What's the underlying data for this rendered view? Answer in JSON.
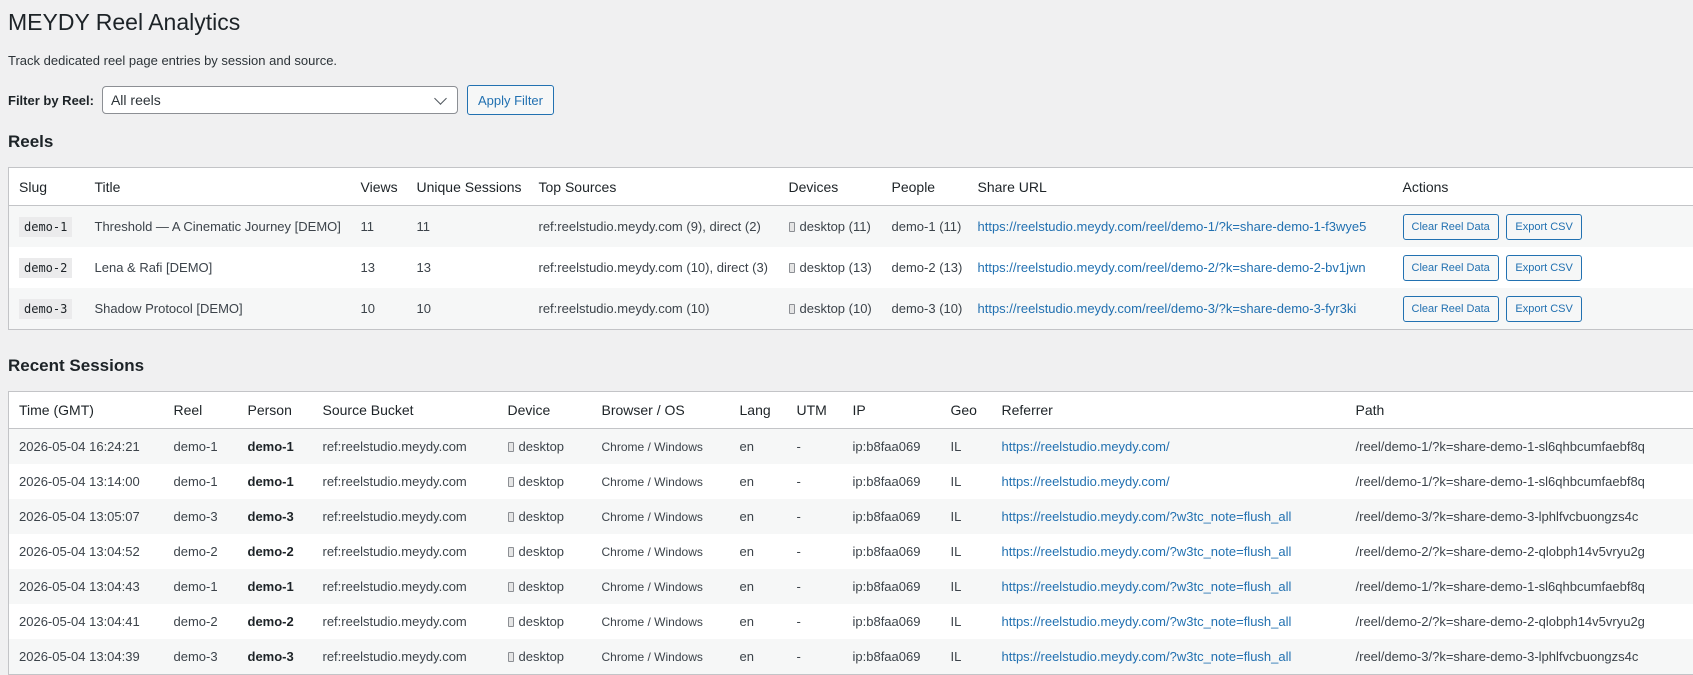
{
  "page": {
    "title": "MEYDY Reel Analytics",
    "description": "Track dedicated reel page entries by session and source."
  },
  "filter": {
    "label": "Filter by Reel:",
    "selected": "All reels",
    "apply_label": "Apply Filter"
  },
  "reels": {
    "heading": "Reels",
    "columns": [
      "Slug",
      "Title",
      "Views",
      "Unique Sessions",
      "Top Sources",
      "Devices",
      "People",
      "Share URL",
      "Actions"
    ],
    "rows": [
      {
        "slug": "demo-1",
        "title": "Threshold — A Cinematic Journey [DEMO]",
        "views": "11",
        "unique": "11",
        "sources": "ref:reelstudio.meydy.com (9), direct (2)",
        "devices": "desktop (11)",
        "people": "demo-1 (11)",
        "url": "https://reelstudio.meydy.com/reel/demo-1/?k=share-demo-1-f3wye5"
      },
      {
        "slug": "demo-2",
        "title": "Lena & Rafi [DEMO]",
        "views": "13",
        "unique": "13",
        "sources": "ref:reelstudio.meydy.com (10), direct (3)",
        "devices": "desktop (13)",
        "people": "demo-2 (13)",
        "url": "https://reelstudio.meydy.com/reel/demo-2/?k=share-demo-2-bv1jwn"
      },
      {
        "slug": "demo-3",
        "title": "Shadow Protocol [DEMO]",
        "views": "10",
        "unique": "10",
        "sources": "ref:reelstudio.meydy.com (10)",
        "devices": "desktop (10)",
        "people": "demo-3 (10)",
        "url": "https://reelstudio.meydy.com/reel/demo-3/?k=share-demo-3-fyr3ki"
      }
    ],
    "clear_label": "Clear Reel Data",
    "export_label": "Export CSV"
  },
  "sessions": {
    "heading": "Recent Sessions",
    "columns": [
      "Time (GMT)",
      "Reel",
      "Person",
      "Source Bucket",
      "Device",
      "Browser / OS",
      "Lang",
      "UTM",
      "IP",
      "Geo",
      "Referrer",
      "Path"
    ],
    "rows": [
      {
        "time": "2026-05-04 16:24:21",
        "reel": "demo-1",
        "person": "demo-1",
        "source": "ref:reelstudio.meydy.com",
        "device": "desktop",
        "browser": "Chrome / Windows",
        "lang": "en",
        "utm": "-",
        "ip": "ip:b8faa069",
        "geo": "IL",
        "referrer": "https://reelstudio.meydy.com/",
        "path": "/reel/demo-1/?k=share-demo-1-sl6qhbcumfaebf8q"
      },
      {
        "time": "2026-05-04 13:14:00",
        "reel": "demo-1",
        "person": "demo-1",
        "source": "ref:reelstudio.meydy.com",
        "device": "desktop",
        "browser": "Chrome / Windows",
        "lang": "en",
        "utm": "-",
        "ip": "ip:b8faa069",
        "geo": "IL",
        "referrer": "https://reelstudio.meydy.com/",
        "path": "/reel/demo-1/?k=share-demo-1-sl6qhbcumfaebf8q"
      },
      {
        "time": "2026-05-04 13:05:07",
        "reel": "demo-3",
        "person": "demo-3",
        "source": "ref:reelstudio.meydy.com",
        "device": "desktop",
        "browser": "Chrome / Windows",
        "lang": "en",
        "utm": "-",
        "ip": "ip:b8faa069",
        "geo": "IL",
        "referrer": "https://reelstudio.meydy.com/?w3tc_note=flush_all",
        "path": "/reel/demo-3/?k=share-demo-3-lphlfvcbuongzs4c"
      },
      {
        "time": "2026-05-04 13:04:52",
        "reel": "demo-2",
        "person": "demo-2",
        "source": "ref:reelstudio.meydy.com",
        "device": "desktop",
        "browser": "Chrome / Windows",
        "lang": "en",
        "utm": "-",
        "ip": "ip:b8faa069",
        "geo": "IL",
        "referrer": "https://reelstudio.meydy.com/?w3tc_note=flush_all",
        "path": "/reel/demo-2/?k=share-demo-2-qlobph14v5vryu2g"
      },
      {
        "time": "2026-05-04 13:04:43",
        "reel": "demo-1",
        "person": "demo-1",
        "source": "ref:reelstudio.meydy.com",
        "device": "desktop",
        "browser": "Chrome / Windows",
        "lang": "en",
        "utm": "-",
        "ip": "ip:b8faa069",
        "geo": "IL",
        "referrer": "https://reelstudio.meydy.com/?w3tc_note=flush_all",
        "path": "/reel/demo-1/?k=share-demo-1-sl6qhbcumfaebf8q"
      },
      {
        "time": "2026-05-04 13:04:41",
        "reel": "demo-2",
        "person": "demo-2",
        "source": "ref:reelstudio.meydy.com",
        "device": "desktop",
        "browser": "Chrome / Windows",
        "lang": "en",
        "utm": "-",
        "ip": "ip:b8faa069",
        "geo": "IL",
        "referrer": "https://reelstudio.meydy.com/?w3tc_note=flush_all",
        "path": "/reel/demo-2/?k=share-demo-2-qlobph14v5vryu2g"
      },
      {
        "time": "2026-05-04 13:04:39",
        "reel": "demo-3",
        "person": "demo-3",
        "source": "ref:reelstudio.meydy.com",
        "device": "desktop",
        "browser": "Chrome / Windows",
        "lang": "en",
        "utm": "-",
        "ip": "ip:b8faa069",
        "geo": "IL",
        "referrer": "https://reelstudio.meydy.com/?w3tc_note=flush_all",
        "path": "/reel/demo-3/?k=share-demo-3-lphlfvcbuongzs4c"
      }
    ]
  }
}
